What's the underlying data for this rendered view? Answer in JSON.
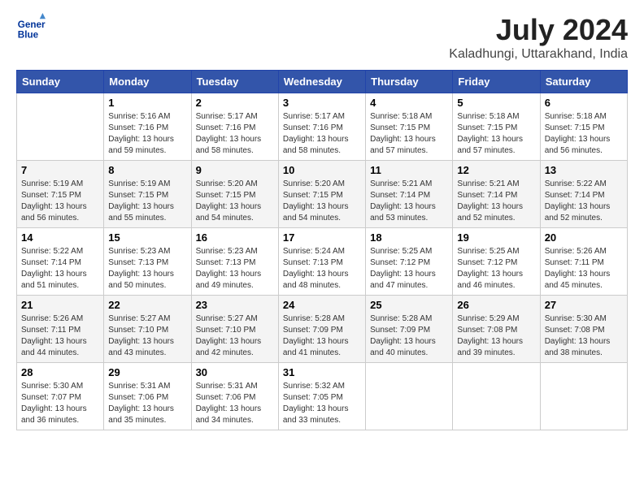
{
  "header": {
    "logo_line1": "General",
    "logo_line2": "Blue",
    "month_year": "July 2024",
    "location": "Kaladhungi, Uttarakhand, India"
  },
  "weekdays": [
    "Sunday",
    "Monday",
    "Tuesday",
    "Wednesday",
    "Thursday",
    "Friday",
    "Saturday"
  ],
  "weeks": [
    [
      {
        "day": "",
        "empty": true
      },
      {
        "day": "1",
        "sunrise": "5:16 AM",
        "sunset": "7:16 PM",
        "daylight": "13 hours and 59 minutes."
      },
      {
        "day": "2",
        "sunrise": "5:17 AM",
        "sunset": "7:16 PM",
        "daylight": "13 hours and 58 minutes."
      },
      {
        "day": "3",
        "sunrise": "5:17 AM",
        "sunset": "7:16 PM",
        "daylight": "13 hours and 58 minutes."
      },
      {
        "day": "4",
        "sunrise": "5:18 AM",
        "sunset": "7:15 PM",
        "daylight": "13 hours and 57 minutes."
      },
      {
        "day": "5",
        "sunrise": "5:18 AM",
        "sunset": "7:15 PM",
        "daylight": "13 hours and 57 minutes."
      },
      {
        "day": "6",
        "sunrise": "5:18 AM",
        "sunset": "7:15 PM",
        "daylight": "13 hours and 56 minutes."
      }
    ],
    [
      {
        "day": "7",
        "sunrise": "5:19 AM",
        "sunset": "7:15 PM",
        "daylight": "13 hours and 56 minutes."
      },
      {
        "day": "8",
        "sunrise": "5:19 AM",
        "sunset": "7:15 PM",
        "daylight": "13 hours and 55 minutes."
      },
      {
        "day": "9",
        "sunrise": "5:20 AM",
        "sunset": "7:15 PM",
        "daylight": "13 hours and 54 minutes."
      },
      {
        "day": "10",
        "sunrise": "5:20 AM",
        "sunset": "7:15 PM",
        "daylight": "13 hours and 54 minutes."
      },
      {
        "day": "11",
        "sunrise": "5:21 AM",
        "sunset": "7:14 PM",
        "daylight": "13 hours and 53 minutes."
      },
      {
        "day": "12",
        "sunrise": "5:21 AM",
        "sunset": "7:14 PM",
        "daylight": "13 hours and 52 minutes."
      },
      {
        "day": "13",
        "sunrise": "5:22 AM",
        "sunset": "7:14 PM",
        "daylight": "13 hours and 52 minutes."
      }
    ],
    [
      {
        "day": "14",
        "sunrise": "5:22 AM",
        "sunset": "7:14 PM",
        "daylight": "13 hours and 51 minutes."
      },
      {
        "day": "15",
        "sunrise": "5:23 AM",
        "sunset": "7:13 PM",
        "daylight": "13 hours and 50 minutes."
      },
      {
        "day": "16",
        "sunrise": "5:23 AM",
        "sunset": "7:13 PM",
        "daylight": "13 hours and 49 minutes."
      },
      {
        "day": "17",
        "sunrise": "5:24 AM",
        "sunset": "7:13 PM",
        "daylight": "13 hours and 48 minutes."
      },
      {
        "day": "18",
        "sunrise": "5:25 AM",
        "sunset": "7:12 PM",
        "daylight": "13 hours and 47 minutes."
      },
      {
        "day": "19",
        "sunrise": "5:25 AM",
        "sunset": "7:12 PM",
        "daylight": "13 hours and 46 minutes."
      },
      {
        "day": "20",
        "sunrise": "5:26 AM",
        "sunset": "7:11 PM",
        "daylight": "13 hours and 45 minutes."
      }
    ],
    [
      {
        "day": "21",
        "sunrise": "5:26 AM",
        "sunset": "7:11 PM",
        "daylight": "13 hours and 44 minutes."
      },
      {
        "day": "22",
        "sunrise": "5:27 AM",
        "sunset": "7:10 PM",
        "daylight": "13 hours and 43 minutes."
      },
      {
        "day": "23",
        "sunrise": "5:27 AM",
        "sunset": "7:10 PM",
        "daylight": "13 hours and 42 minutes."
      },
      {
        "day": "24",
        "sunrise": "5:28 AM",
        "sunset": "7:09 PM",
        "daylight": "13 hours and 41 minutes."
      },
      {
        "day": "25",
        "sunrise": "5:28 AM",
        "sunset": "7:09 PM",
        "daylight": "13 hours and 40 minutes."
      },
      {
        "day": "26",
        "sunrise": "5:29 AM",
        "sunset": "7:08 PM",
        "daylight": "13 hours and 39 minutes."
      },
      {
        "day": "27",
        "sunrise": "5:30 AM",
        "sunset": "7:08 PM",
        "daylight": "13 hours and 38 minutes."
      }
    ],
    [
      {
        "day": "28",
        "sunrise": "5:30 AM",
        "sunset": "7:07 PM",
        "daylight": "13 hours and 36 minutes."
      },
      {
        "day": "29",
        "sunrise": "5:31 AM",
        "sunset": "7:06 PM",
        "daylight": "13 hours and 35 minutes."
      },
      {
        "day": "30",
        "sunrise": "5:31 AM",
        "sunset": "7:06 PM",
        "daylight": "13 hours and 34 minutes."
      },
      {
        "day": "31",
        "sunrise": "5:32 AM",
        "sunset": "7:05 PM",
        "daylight": "13 hours and 33 minutes."
      },
      {
        "day": "",
        "empty": true
      },
      {
        "day": "",
        "empty": true
      },
      {
        "day": "",
        "empty": true
      }
    ]
  ],
  "labels": {
    "sunrise": "Sunrise:",
    "sunset": "Sunset:",
    "daylight": "Daylight:"
  }
}
